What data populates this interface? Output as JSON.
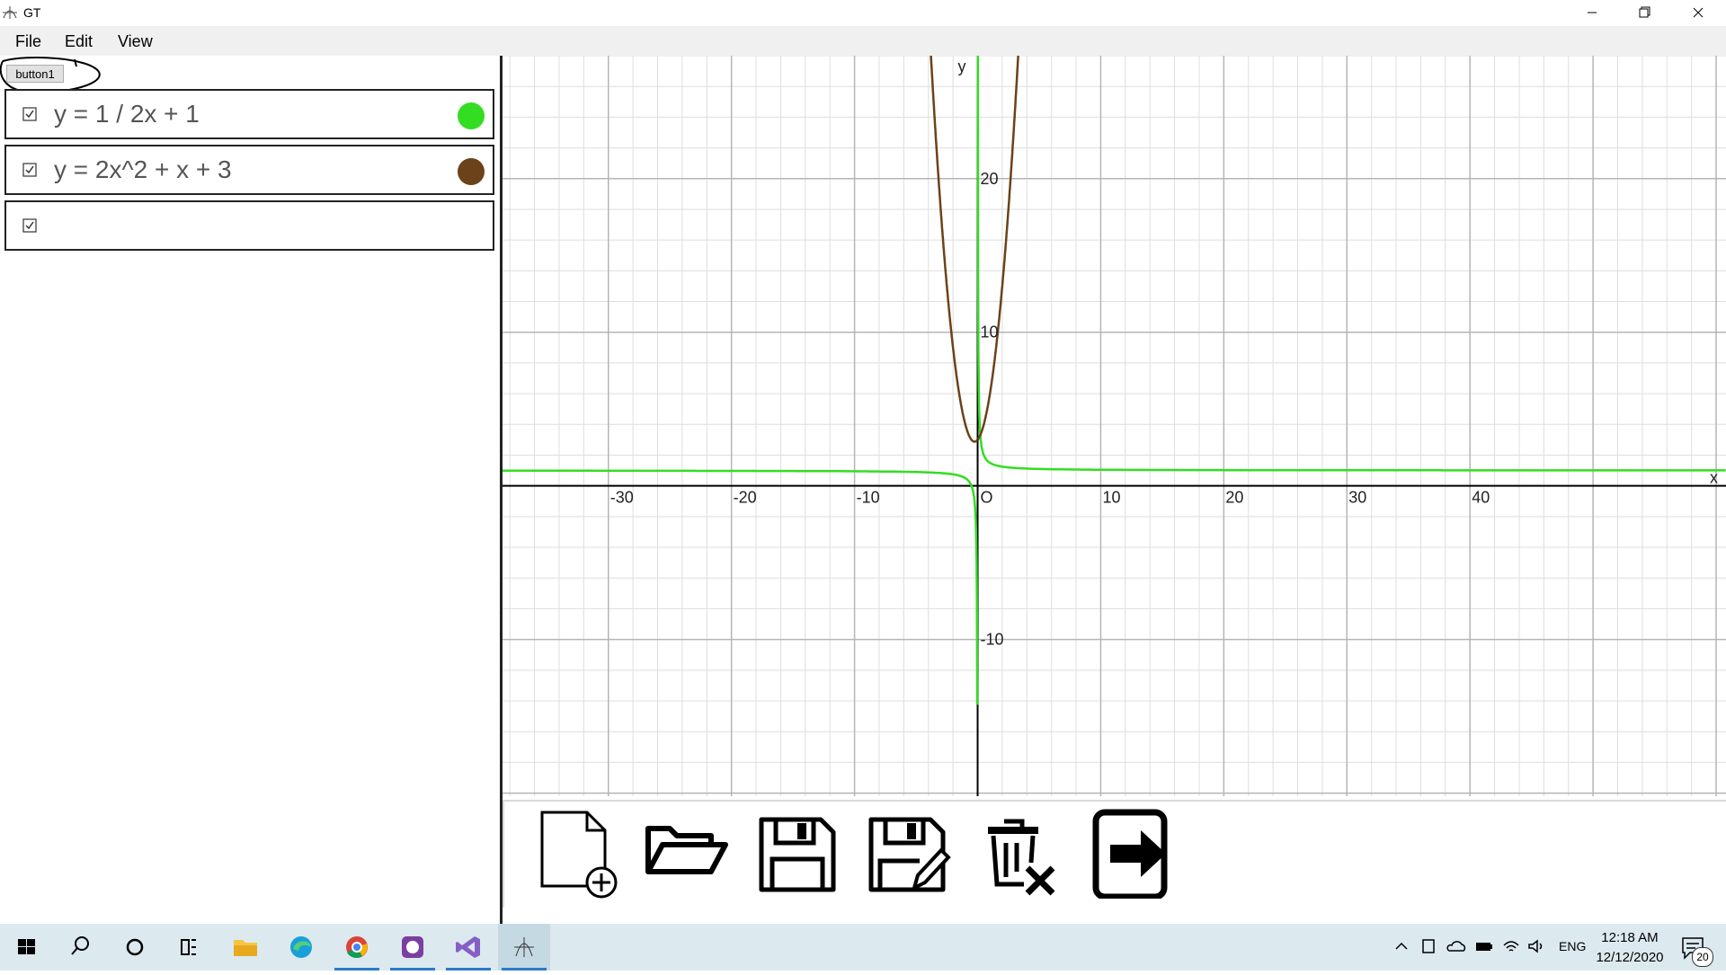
{
  "window": {
    "title": "GT",
    "icon": "graph-app-icon",
    "controls": [
      "minimize-icon",
      "restore-icon",
      "close-icon"
    ]
  },
  "menu": {
    "file": "File",
    "edit": "Edit",
    "view": "View"
  },
  "sidebar": {
    "button1_label": "button1",
    "functions": [
      {
        "checked": true,
        "expression": "y = 1 / 2x + 1",
        "color": "#33dd22"
      },
      {
        "checked": true,
        "expression": "y = 2x^2 + x + 3",
        "color": "#6b4219"
      },
      {
        "checked": true,
        "expression": "",
        "color": ""
      }
    ]
  },
  "graph": {
    "x_axis_label": "x",
    "y_axis_label": "y",
    "origin_label": "O",
    "x_ticks": [
      "-30",
      "-20",
      "-10",
      "10",
      "20",
      "30",
      "40"
    ],
    "y_ticks": [
      "20",
      "10",
      "-10"
    ],
    "x_range": [
      -38.6,
      60.8
    ],
    "y_range": [
      -20.2,
      28
    ],
    "curves": [
      {
        "expression": "y = 1 / 2x + 1",
        "color": "#33dd22"
      },
      {
        "expression": "y = 2x^2 + x + 3",
        "color": "#6b4219"
      }
    ]
  },
  "toolbar": {
    "tools": [
      "new-file-icon",
      "open-folder-icon",
      "save-icon",
      "save-as-icon",
      "delete-icon",
      "exit-icon"
    ]
  },
  "taskbar": {
    "apps": [
      "windows-start-icon",
      "search-icon",
      "cortana-icon",
      "task-view-icon",
      "file-explorer-icon",
      "edge-icon",
      "chrome-icon",
      "github-desktop-icon",
      "visual-studio-icon",
      "gt-app-icon"
    ],
    "tray_language": "ENG",
    "time": "12:18 AM",
    "date": "12/12/2020",
    "notification_count": "20"
  }
}
